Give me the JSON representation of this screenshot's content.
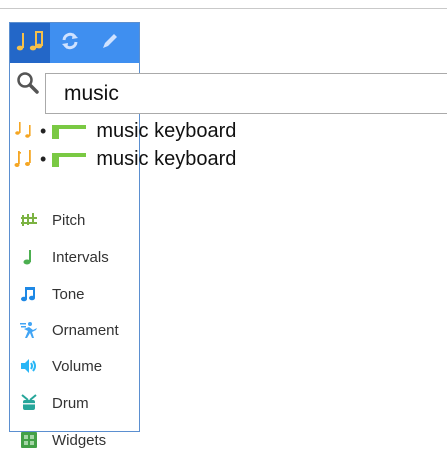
{
  "search": {
    "value": "music"
  },
  "results": [
    {
      "label": "music keyboard",
      "source_icon": "note-icon"
    },
    {
      "label": "music keyboard",
      "source_icon": "note-icon"
    }
  ],
  "categories": [
    {
      "label": "Pitch",
      "icon": "pitch-icon",
      "color": "#7cb342"
    },
    {
      "label": "Intervals",
      "icon": "intervals-icon",
      "color": "#4caf50"
    },
    {
      "label": "Tone",
      "icon": "tone-icon",
      "color": "#1e88e5"
    },
    {
      "label": "Ornament",
      "icon": "ornament-icon",
      "color": "#42a5f5"
    },
    {
      "label": "Volume",
      "icon": "volume-icon",
      "color": "#29b6f6"
    },
    {
      "label": "Drum",
      "icon": "drum-icon",
      "color": "#26a69a"
    },
    {
      "label": "Widgets",
      "icon": "widgets-icon",
      "color": "#43a047"
    }
  ],
  "colors": {
    "tab_bar": "#3f8ff0",
    "tab_active": "#2367c8",
    "note_orange": "#f5a623",
    "block_green": "#7ac943"
  }
}
